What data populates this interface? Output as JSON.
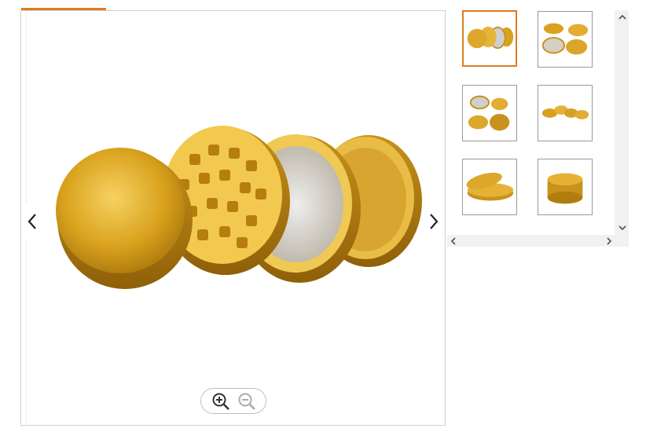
{
  "gallery": {
    "main_image": {
      "icon": "grinder-product-image",
      "color": "#d9a21d"
    },
    "prev_icon": "chevron-left-icon",
    "next_icon": "chevron-right-icon",
    "zoom": {
      "in_icon": "zoom-in-icon",
      "out_icon": "zoom-out-icon"
    },
    "accent_color": "#e07a1f",
    "thumbnails": [
      {
        "icon": "grinder-all-parts-thumbnail",
        "selected": true
      },
      {
        "icon": "grinder-top-view-thumbnail",
        "selected": false
      },
      {
        "icon": "grinder-open-lids-thumbnail",
        "selected": false
      },
      {
        "icon": "grinder-stacked-parts-thumbnail",
        "selected": false
      },
      {
        "icon": "grinder-half-open-thumbnail",
        "selected": false
      },
      {
        "icon": "grinder-closed-thumbnail",
        "selected": false
      }
    ],
    "scrollbars": {
      "up_icon": "scroll-up-arrow-icon",
      "down_icon": "scroll-down-arrow-icon",
      "left_icon": "scroll-left-arrow-icon",
      "right_icon": "scroll-right-arrow-icon"
    }
  }
}
